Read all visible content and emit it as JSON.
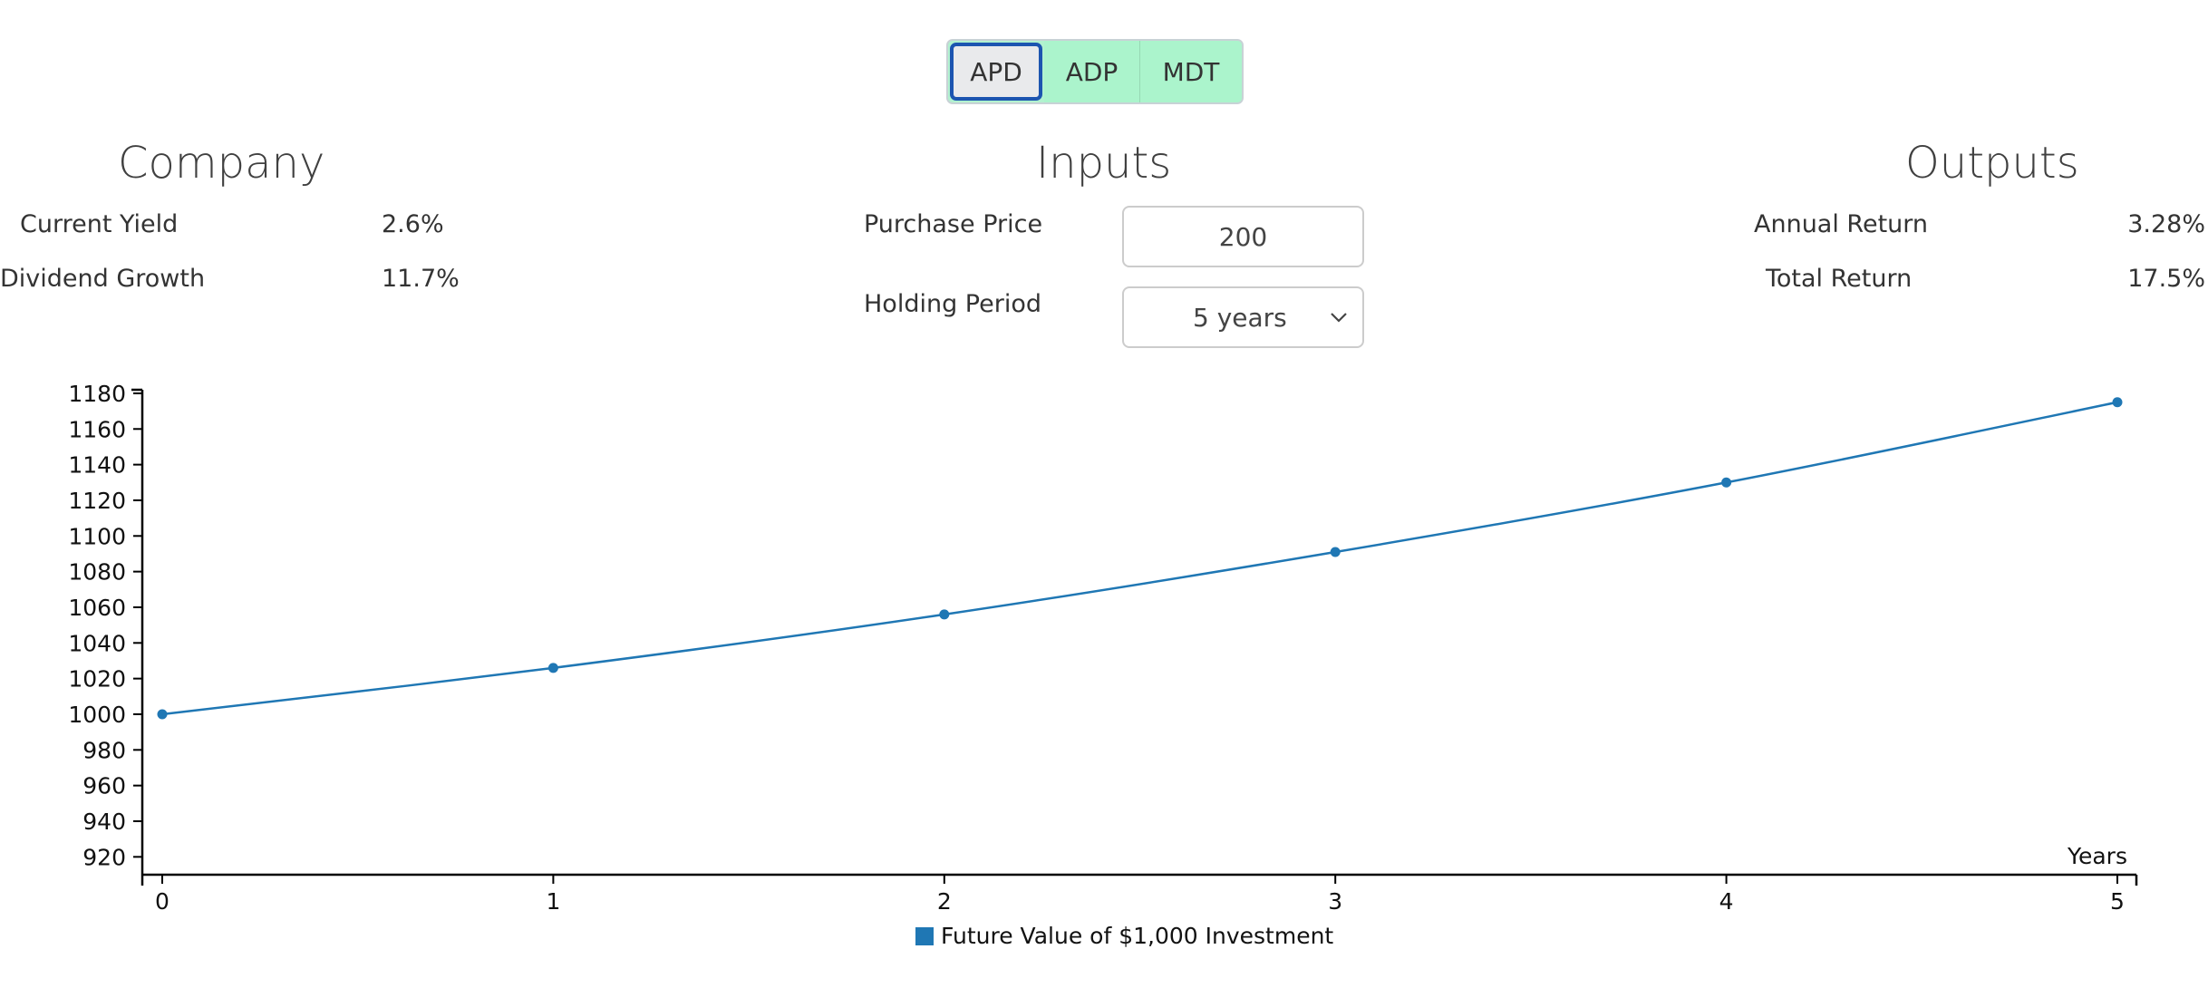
{
  "tickers": [
    {
      "label": "APD",
      "active": true
    },
    {
      "label": "ADP",
      "active": false
    },
    {
      "label": "MDT",
      "active": false
    }
  ],
  "company": {
    "title": "Company",
    "rows": [
      {
        "label": "Current Yield",
        "value": "2.6%"
      },
      {
        "label": "Dividend Growth",
        "value": "11.7%"
      }
    ]
  },
  "inputs": {
    "title": "Inputs",
    "purchase_price_label": "Purchase Price",
    "purchase_price_value": "200",
    "holding_period_label": "Holding Period",
    "holding_period_value": "5 years"
  },
  "outputs": {
    "title": "Outputs",
    "rows": [
      {
        "label": "Annual Return",
        "value": "3.28%"
      },
      {
        "label": "Total Return",
        "value": "17.5%"
      }
    ]
  },
  "colors": {
    "series": "#1f77b4",
    "ticker_bg": "#abf4cc",
    "active_border": "#1c55b0"
  },
  "chart_data": {
    "type": "line",
    "xlabel": "Years",
    "ylabel": "",
    "title": "",
    "x": [
      0,
      1,
      2,
      3,
      4,
      5
    ],
    "x_ticks": [
      "0",
      "1",
      "2",
      "3",
      "4",
      "5"
    ],
    "y_ticks": [
      920,
      940,
      960,
      980,
      1000,
      1020,
      1040,
      1060,
      1080,
      1100,
      1120,
      1140,
      1160,
      1180
    ],
    "ylim": [
      910,
      1182
    ],
    "xlim": [
      -0.05,
      5.05
    ],
    "series": [
      {
        "name": "Future Value of $1,000 Investment",
        "values": [
          1000,
          1026,
          1056,
          1091,
          1130,
          1175
        ]
      }
    ],
    "legend_position": "bottom-center",
    "grid": false
  }
}
